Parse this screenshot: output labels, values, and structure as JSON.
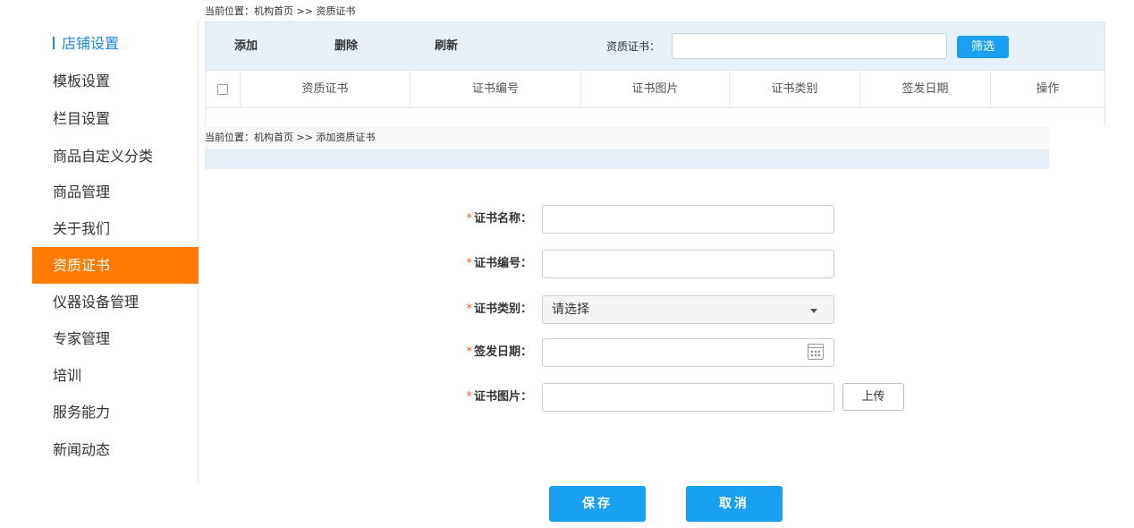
{
  "breadcrumb_top": "当前位置：机构首页 >> 资质证书",
  "sidebar": {
    "items": [
      {
        "label": "店铺设置",
        "state": "header"
      },
      {
        "label": "模板设置"
      },
      {
        "label": "栏目设置"
      },
      {
        "label": "商品自定义分类"
      },
      {
        "label": "商品管理"
      },
      {
        "label": "关于我们"
      },
      {
        "label": "资质证书",
        "state": "active"
      },
      {
        "label": "仪器设备管理"
      },
      {
        "label": "专家管理"
      },
      {
        "label": "培训"
      },
      {
        "label": "服务能力"
      },
      {
        "label": "新闻动态"
      }
    ],
    "accent_color": "#1e88e5",
    "active_color": "#ff7a00"
  },
  "toolbar": {
    "add": "添加",
    "delete": "删除",
    "refresh": "刷新",
    "filter_label": "资质证书：",
    "filter_value": "",
    "filter_button": "筛选"
  },
  "table": {
    "columns": [
      "资质证书",
      "证书编号",
      "证书图片",
      "证书类别",
      "签发日期",
      "操作"
    ]
  },
  "form": {
    "breadcrumb": "当前位置：机构首页 >> 添加资质证书",
    "required_mark": "*",
    "fields": {
      "name_label": "证书名称：",
      "name_value": "",
      "number_label": "证书编号：",
      "number_value": "",
      "type_label": "证书类别：",
      "type_selected": "请选择",
      "date_label": "签发日期：",
      "date_value": "",
      "image_label": "证书图片：",
      "image_value": "",
      "upload_button": "上传"
    },
    "save_button": "保存",
    "cancel_button": "取消"
  },
  "icons": {
    "calendar": "calendar-icon",
    "dropdown": "chevron-down-icon",
    "checkbox": "checkbox-icon"
  },
  "colors": {
    "primary_button": "#1aa0f0",
    "required_star": "#ff5a1f",
    "panel_bg": "#e6f0f8"
  }
}
